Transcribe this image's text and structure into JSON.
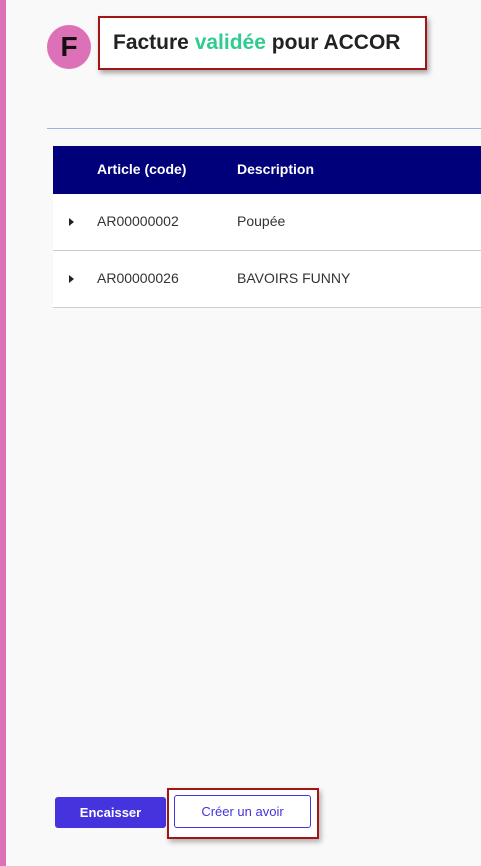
{
  "header": {
    "avatar_letter": "F",
    "title_prefix": "Facture",
    "title_status": "validée",
    "title_suffix": "pour ACCOR"
  },
  "table": {
    "columns": [
      "Article (code)",
      "Description"
    ],
    "rows": [
      {
        "code": "AR00000002",
        "description": "Poupée"
      },
      {
        "code": "AR00000026",
        "description": "BAVOIRS FUNNY"
      }
    ]
  },
  "actions": {
    "cash_in_label": "Encaisser",
    "create_credit_label": "Créer un avoir"
  },
  "colors": {
    "accent": "#4533dd",
    "header_bg": "#00007a",
    "status_green": "#2ecc8f",
    "avatar_pink": "#dd71b7"
  }
}
